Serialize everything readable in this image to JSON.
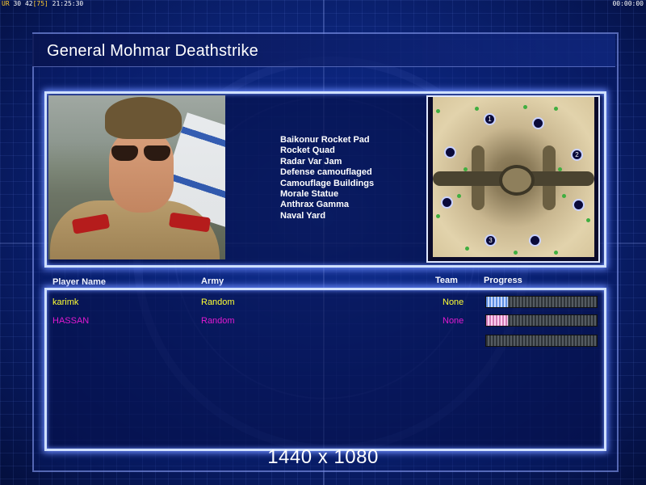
{
  "status_bar": {
    "left_label": "UR",
    "left_a": "30",
    "left_b": "42",
    "left_c": "[75]",
    "clock": "21:25:30",
    "timer": "00:00:00"
  },
  "title": "General Mohmar Deathstrike",
  "general_abilities": [
    "Baikonur Rocket Pad",
    "Rocket Quad",
    "Radar Var Jam",
    "Defense camouflaged",
    "Camouflage Buildings",
    "Morale Statue",
    "Anthrax Gamma",
    "Naval Yard"
  ],
  "minimap": {
    "spawn_labels": [
      "1",
      "2",
      "3"
    ]
  },
  "table": {
    "headers": {
      "player_name": "Player Name",
      "army": "Army",
      "team": "Team",
      "progress": "Progress"
    },
    "rows": [
      {
        "name": "karimk",
        "army": "Random",
        "team": "None",
        "progress": 0.2,
        "color": "#ffff33"
      },
      {
        "name": "HASSAN",
        "army": "Random",
        "team": "None",
        "progress": 0.2,
        "color": "#e21ad0"
      },
      {
        "name": "",
        "army": "",
        "team": "",
        "progress": 0.0,
        "color": "#5060b0"
      }
    ]
  },
  "resolution": "1440 x 1080",
  "colors": {
    "frame_glow": "#6c8cff",
    "background": "#0e2a86"
  }
}
